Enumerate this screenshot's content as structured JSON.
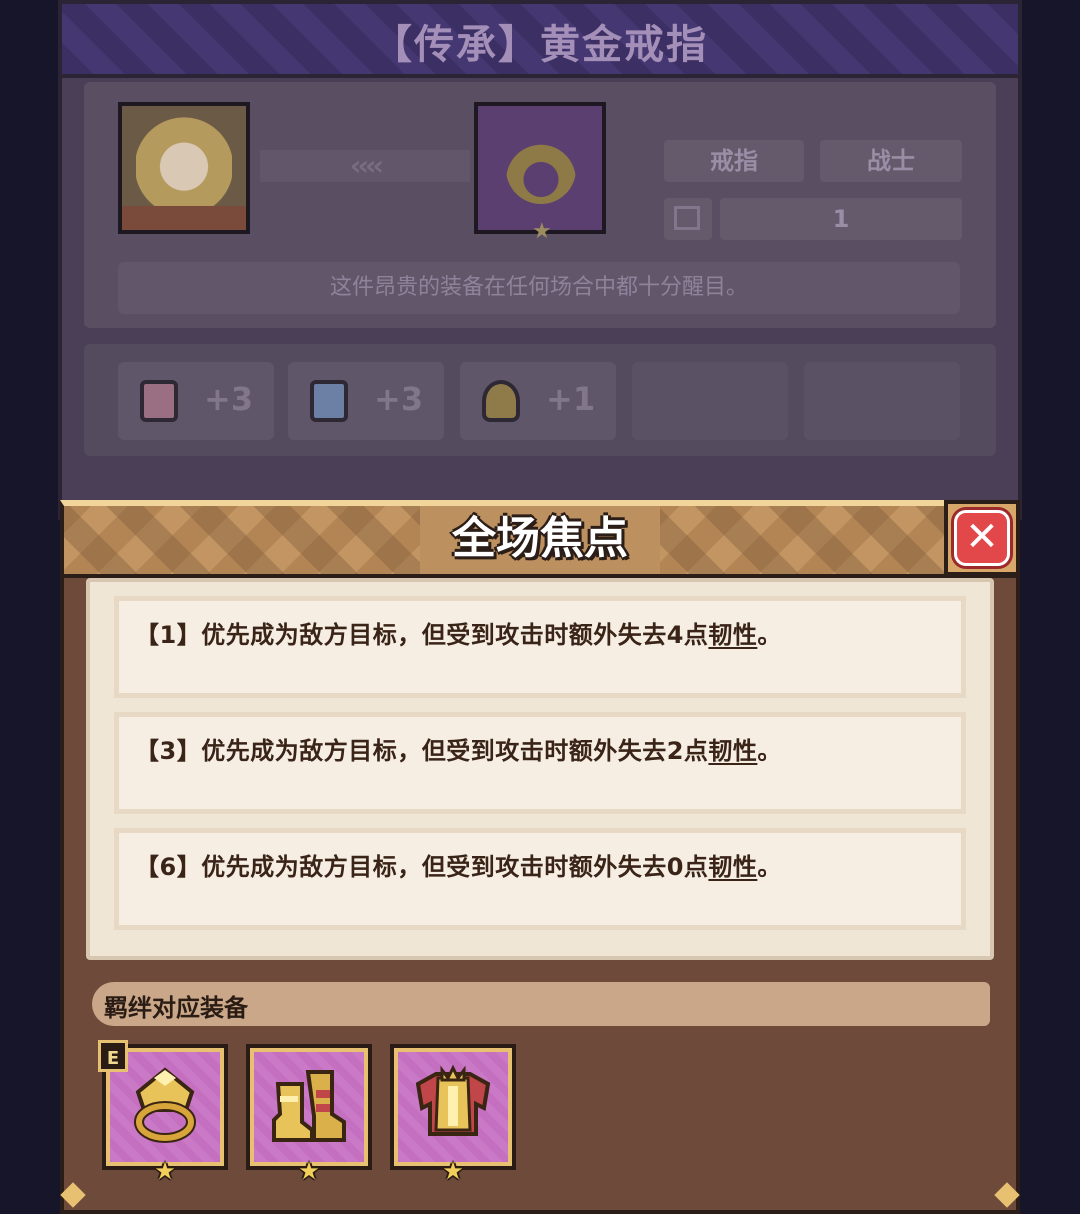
{
  "background_panel": {
    "title": "【传承】黄金戒指",
    "type_label": "戒指",
    "class_label": "战士",
    "level_value": "1",
    "description": "这件昂贵的装备在任何场合中都十分醒目。",
    "stats": [
      {
        "icon": "armor-icon",
        "value": "+3"
      },
      {
        "icon": "book-icon",
        "value": "+3"
      },
      {
        "icon": "bag-icon",
        "value": "+1"
      }
    ]
  },
  "popup": {
    "title": "全场焦点",
    "close_icon": "close-icon",
    "effects": [
      {
        "prefix": "【1】优先成为敌方目标，但受到攻击时额外失去4点",
        "keyword": "韧性",
        "suffix": "。"
      },
      {
        "prefix": "【3】优先成为敌方目标，但受到攻击时额外失去2点",
        "keyword": "韧性",
        "suffix": "。"
      },
      {
        "prefix": "【6】优先成为敌方目标，但受到攻击时额外失去0点",
        "keyword": "韧性",
        "suffix": "。"
      }
    ],
    "bond_title": "羁绊对应装备",
    "equipped_badge": "E",
    "bond_items": [
      {
        "icon": "golden-ring-icon"
      },
      {
        "icon": "golden-boots-icon"
      },
      {
        "icon": "golden-armor-icon"
      }
    ]
  },
  "colors": {
    "accent_gold": "#e8c071",
    "close_red": "#e2484a",
    "slot_purple": "#c56fc0"
  }
}
